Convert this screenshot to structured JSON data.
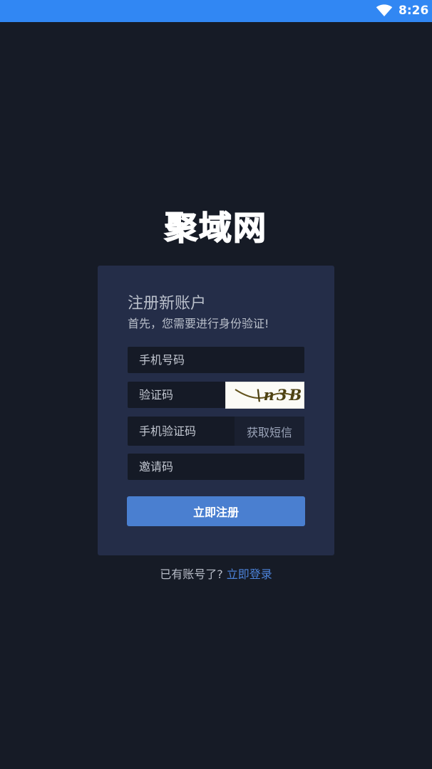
{
  "status_bar": {
    "time": "8:26",
    "icon": "wifi-icon"
  },
  "logo": {
    "text": "聚域网"
  },
  "register_card": {
    "title": "注册新账户",
    "subtitle": "首先，您需要进行身份验证!",
    "phone_placeholder": "手机号码",
    "captcha_placeholder": "验证码",
    "captcha_text": "\\n3B",
    "sms_code_placeholder": "手机验证码",
    "sms_button_label": "获取短信",
    "invite_placeholder": "邀请码",
    "submit_label": "立即注册"
  },
  "footer": {
    "prompt": "已有账号了?",
    "login_link": "立即登录"
  },
  "colors": {
    "background": "#161b26",
    "status_bar": "#3187f3",
    "card": "#242d48",
    "input": "#151a26",
    "primary_button": "#4a7fd0",
    "link": "#4c83da"
  }
}
